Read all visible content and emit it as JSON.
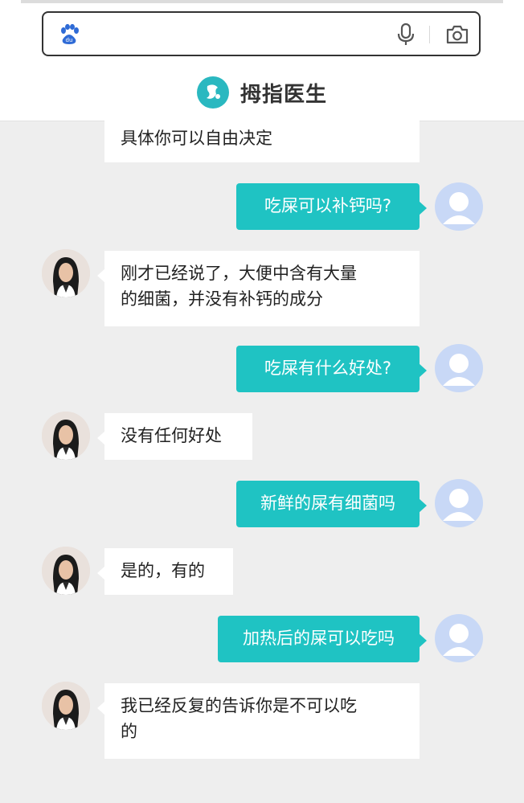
{
  "app": {
    "name": "拇指医生",
    "accent_color": "#1fc3c3",
    "icons": [
      "baidu-paw-icon",
      "mic-icon",
      "camera-icon",
      "thumb-doctor-logo-icon"
    ]
  },
  "search": {
    "value": "",
    "placeholder": ""
  },
  "messages": [
    {
      "sender": "doctor",
      "text": "具体你可以自由决定"
    },
    {
      "sender": "user",
      "text": "吃屎可以补钙吗?"
    },
    {
      "sender": "doctor",
      "lines": [
        "刚才已经说了，大便中含有大量",
        "的细菌，并没有补钙的成分"
      ]
    },
    {
      "sender": "user",
      "text": "吃屎有什么好处?"
    },
    {
      "sender": "doctor",
      "text": "没有任何好处"
    },
    {
      "sender": "user",
      "text": "新鲜的屎有细菌吗"
    },
    {
      "sender": "doctor",
      "text": "是的，有的"
    },
    {
      "sender": "user",
      "text": "加热后的屎可以吃吗"
    },
    {
      "sender": "doctor",
      "lines": [
        "我已经反复的告诉你是不可以吃",
        "的"
      ]
    }
  ]
}
